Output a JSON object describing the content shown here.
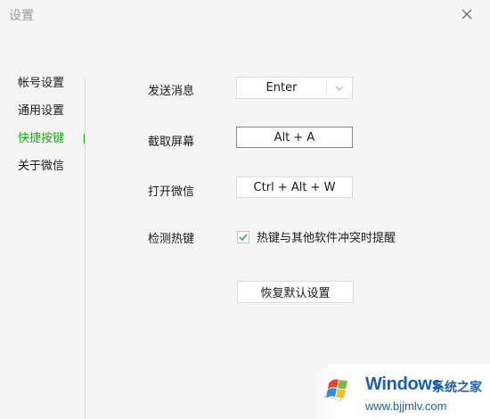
{
  "window": {
    "title": "设置"
  },
  "sidebar": {
    "items": [
      {
        "label": "帐号设置"
      },
      {
        "label": "通用设置"
      },
      {
        "label": "快捷按键"
      },
      {
        "label": "关于微信"
      }
    ],
    "active_index": 2
  },
  "shortcuts": {
    "send_message": {
      "label": "发送消息",
      "value": "Enter"
    },
    "screenshot": {
      "label": "截取屏幕",
      "value": "Alt + A"
    },
    "open_wechat": {
      "label": "打开微信",
      "value": "Ctrl + Alt + W"
    },
    "detect_hotkey": {
      "label": "检测热键",
      "checkbox_label": "热键与其他软件冲突时提醒",
      "checked": true
    },
    "reset_label": "恢复默认设置"
  },
  "watermark": {
    "brand": "Windows",
    "cn": "系统之家",
    "url": "www.bjjmlv.com"
  },
  "colors": {
    "accent": "#1aad19",
    "background": "#f5f5f5",
    "watermark": "#1a5fb4"
  },
  "icons": {
    "close": "close-icon",
    "dropdown": "chevron-down-icon",
    "check": "checkmark-icon",
    "logo": "windows-logo-icon"
  }
}
